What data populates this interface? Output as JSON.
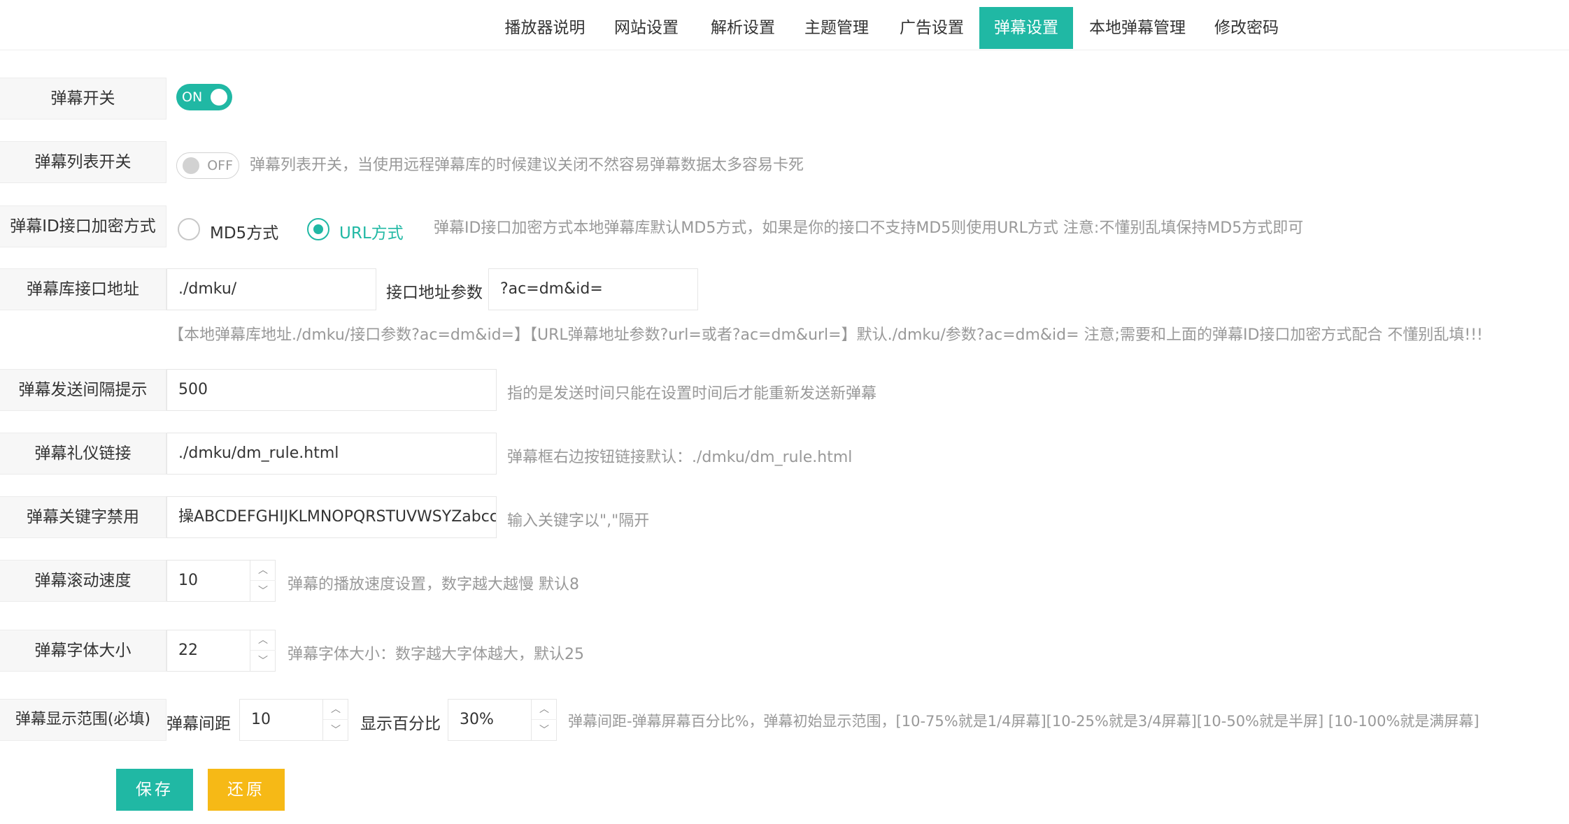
{
  "tabs": [
    {
      "label": "播放器说明",
      "active": false
    },
    {
      "label": "网站设置",
      "active": false
    },
    {
      "label": "解析设置",
      "active": false
    },
    {
      "label": "主题管理",
      "active": false
    },
    {
      "label": "广告设置",
      "active": false
    },
    {
      "label": "弹幕设置",
      "active": true
    },
    {
      "label": "本地弹幕管理",
      "active": false
    },
    {
      "label": "修改密码",
      "active": false
    }
  ],
  "danmu_switch": {
    "label": "弹幕开关",
    "state": "ON"
  },
  "list_switch": {
    "label": "弹幕列表开关",
    "state": "OFF",
    "hint": "弹幕列表开关，当使用远程弹幕库的时候建议关闭不然容易弹幕数据太多容易卡死"
  },
  "encrypt": {
    "label": "弹幕ID接口加密方式",
    "option_md5": "MD5方式",
    "option_url": "URL方式",
    "selected": "URL方式",
    "hint": "弹幕ID接口加密方式本地弹幕库默认MD5方式，如果是你的接口不支持MD5则使用URL方式 注意:不懂别乱填保持MD5方式即可"
  },
  "api": {
    "label": "弹幕库接口地址",
    "value": "./dmku/",
    "param_label": "接口地址参数",
    "param_value": "?ac=dm&id=",
    "hint": "【本地弹幕库地址./dmku/接口参数?ac=dm&id=】【URL弹幕地址参数?url=或者?ac=dm&url=】默认./dmku/参数?ac=dm&id= 注意;需要和上面的弹幕ID接口加密方式配合 不懂别乱填!!!"
  },
  "interval": {
    "label": "弹幕发送间隔提示",
    "value": "500",
    "hint": "指的是发送时间只能在设置时间后才能重新发送新弹幕"
  },
  "rule_link": {
    "label": "弹幕礼仪链接",
    "value": "./dmku/dm_rule.html",
    "hint": "弹幕框右边按钮链接默认：./dmku/dm_rule.html"
  },
  "keywords": {
    "label": "弹幕关键字禁用",
    "value": "操ABCDEFGHIJKLMNOPQRSTUVWSYZabcc",
    "hint": "输入关键字以\",\"隔开"
  },
  "speed": {
    "label": "弹幕滚动速度",
    "value": "10",
    "hint": "弹幕的播放速度设置，数字越大越慢 默认8"
  },
  "font_size": {
    "label": "弹幕字体大小",
    "value": "22",
    "hint": "弹幕字体大小：数字越大字体越大，默认25"
  },
  "range": {
    "label": "弹幕显示范围(必填)",
    "gap_label": "弹幕间距",
    "gap_value": "10",
    "percent_label": "显示百分比",
    "percent_value": "30%",
    "hint": "弹幕间距-弹幕屏幕百分比%，弹幕初始显示范围，[10-75%就是1/4屏幕][10-25%就是3/4屏幕][10-50%就是半屏] [10-100%就是满屏幕]"
  },
  "buttons": {
    "save": "保存",
    "reset": "还原"
  },
  "icons": {
    "up": "chevron-up-icon",
    "down": "chevron-down-icon"
  },
  "colors": {
    "accent": "#20b8a4",
    "warning": "#f6b916"
  }
}
